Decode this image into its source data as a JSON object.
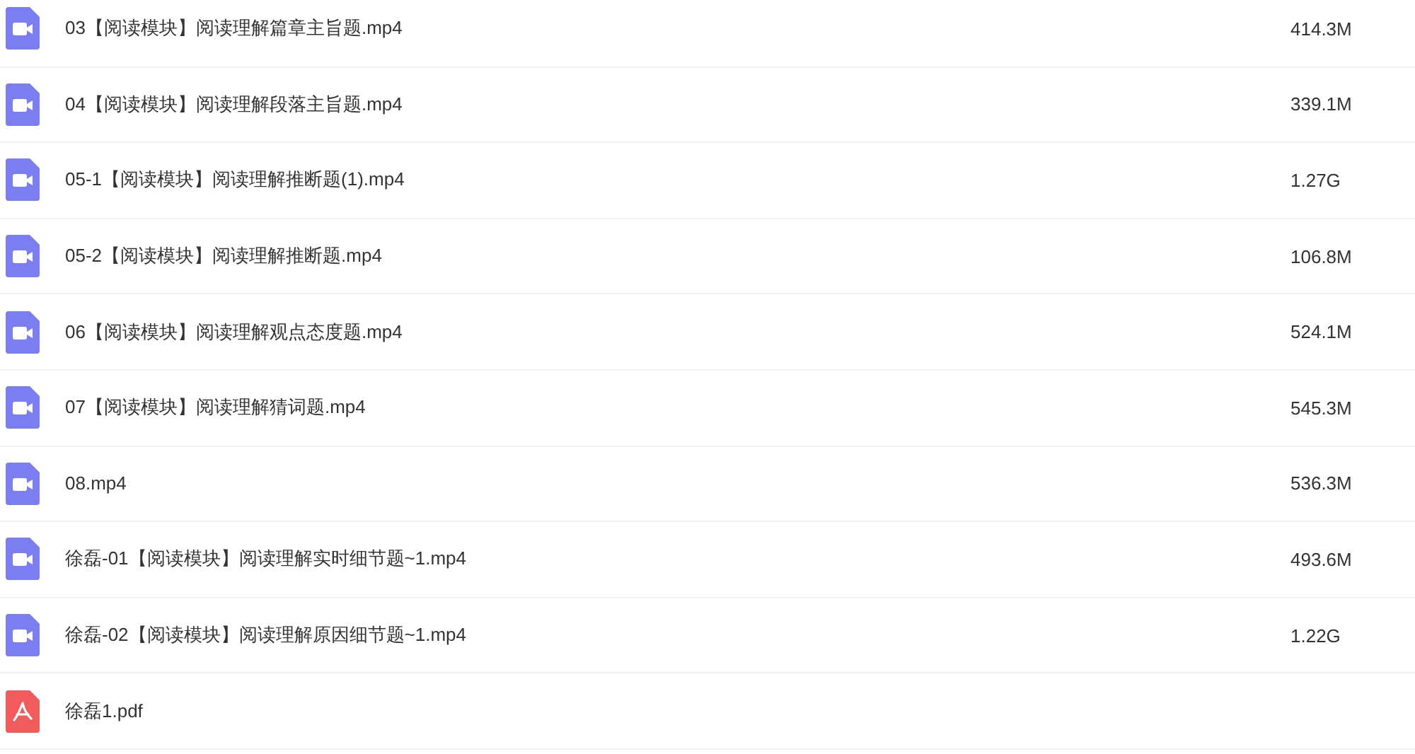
{
  "files": [
    {
      "kind": "video",
      "name": "03【阅读模块】阅读理解篇章主旨题.mp4",
      "size": "414.3M"
    },
    {
      "kind": "video",
      "name": "04【阅读模块】阅读理解段落主旨题.mp4",
      "size": "339.1M"
    },
    {
      "kind": "video",
      "name": "05-1【阅读模块】阅读理解推断题(1).mp4",
      "size": "1.27G"
    },
    {
      "kind": "video",
      "name": "05-2【阅读模块】阅读理解推断题.mp4",
      "size": "106.8M"
    },
    {
      "kind": "video",
      "name": "06【阅读模块】阅读理解观点态度题.mp4",
      "size": "524.1M"
    },
    {
      "kind": "video",
      "name": "07【阅读模块】阅读理解猜词题.mp4",
      "size": "545.3M"
    },
    {
      "kind": "video",
      "name": "08.mp4",
      "size": "536.3M"
    },
    {
      "kind": "video",
      "name": "徐磊-01【阅读模块】阅读理解实时细节题~1.mp4",
      "size": "493.6M"
    },
    {
      "kind": "video",
      "name": "徐磊-02【阅读模块】阅读理解原因细节题~1.mp4",
      "size": "1.22G"
    },
    {
      "kind": "pdf",
      "name": "徐磊1.pdf"
    }
  ]
}
